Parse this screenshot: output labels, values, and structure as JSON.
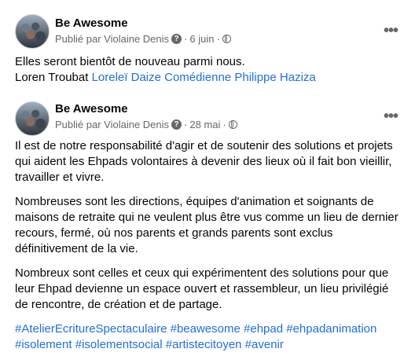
{
  "post1": {
    "page_name": "Be Awesome",
    "published_by": "Publié par Violaine Denis",
    "date": "6 juin",
    "separator": "·",
    "more": "•••",
    "text_line": "Elles seront bientôt de nouveau parmi nous.",
    "tag_plain": "Loren Troubat",
    "tag_links": [
      "Loreleï Daize Comédienne",
      "Philippe Haziza"
    ]
  },
  "post2": {
    "page_name": "Be Awesome",
    "published_by": "Publié par Violaine Denis",
    "date": "28 mai",
    "separator": "·",
    "more": "•••",
    "paragraphs": [
      "Il est de notre responsabilité d'agir et de soutenir des solutions et projets qui aident les Ehpads volontaires à devenir des lieux où il fait bon vieillir, travailler et vivre.",
      "Nombreuses sont les directions, équipes d'animation et soignants de maisons de retraite qui ne veulent plus être vus comme un lieu de dernier recours, fermé, où nos parents et grands parents sont exclus définitivement de la vie.",
      "Nombreux sont celles et ceux qui expérimentent des solutions pour que leur Ehpad devienne un espace ouvert et rassembleur, un lieu privilégié de rencontre, de création et de partage."
    ],
    "hashtags": [
      "#AtelierEcritureSpectaculaire",
      "#beawesome",
      "#ehpad",
      "#ehpadanimation",
      "#isolement",
      "#isolementsocial",
      "#artistecitoyen",
      "#avenir"
    ]
  },
  "icons": {
    "info": "question-circle-icon",
    "audience": "globe-icon"
  },
  "colors": {
    "link": "#216fdb",
    "meta": "#65676b",
    "text": "#050505"
  }
}
